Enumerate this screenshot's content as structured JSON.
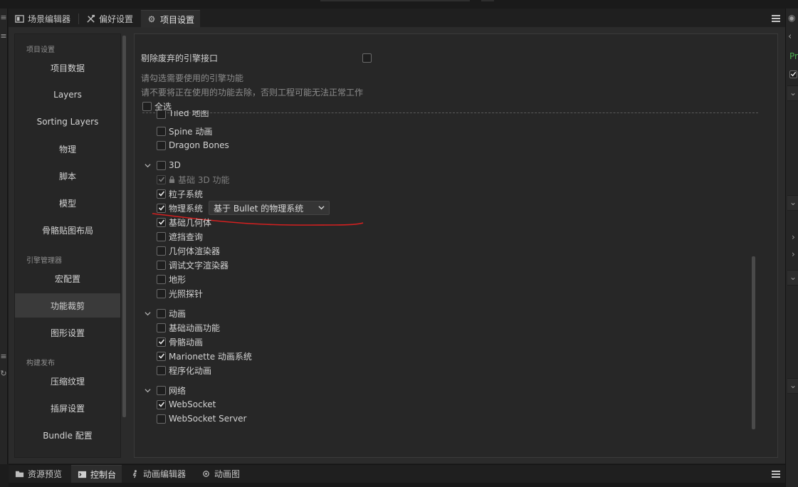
{
  "tabs": [
    {
      "label": "场景编辑器",
      "icon": "scene-editor-icon"
    },
    {
      "label": "偏好设置",
      "icon": "tools-icon"
    },
    {
      "label": "项目设置",
      "icon": "gear-icon",
      "active": true
    }
  ],
  "sidebar": {
    "sections": [
      {
        "header": "项目设置",
        "items": [
          "项目数据",
          "Layers",
          "Sorting Layers",
          "物理",
          "脚本",
          "模型",
          "骨骼贴图布局"
        ]
      },
      {
        "header": "引擎管理器",
        "items": [
          "宏配置",
          "功能裁剪",
          "图形设置"
        ]
      },
      {
        "header": "构建发布",
        "items": [
          "压缩纹理",
          "插屏设置",
          "Bundle 配置"
        ]
      }
    ],
    "selected": "功能裁剪"
  },
  "panel": {
    "deprecated_label": "剔除废弃的引擎接口",
    "hint1": "请勾选需要使用的引擎功能",
    "hint2": "请不要将正在使用的功能去除，否则工程可能无法正常工作",
    "select_all": "全选",
    "partial_top": "Tiled 地图",
    "items_2d": [
      {
        "label": "Spine 动画",
        "checked": false
      },
      {
        "label": "Dragon Bones",
        "checked": false
      }
    ],
    "group_3d": {
      "label": "3D",
      "items": [
        {
          "label": "基础 3D 功能",
          "checked": true,
          "locked": true
        },
        {
          "label": "粒子系统",
          "checked": true
        },
        {
          "label": "物理系统",
          "checked": true,
          "dropdown": "基于 Bullet 的物理系统"
        },
        {
          "label": "基础几何体",
          "checked": true
        },
        {
          "label": "遮挡查询",
          "checked": false
        },
        {
          "label": "几何体渲染器",
          "checked": false
        },
        {
          "label": "调试文字渲染器",
          "checked": false
        },
        {
          "label": "地形",
          "checked": false
        },
        {
          "label": "光照探针",
          "checked": false
        }
      ]
    },
    "group_anim": {
      "label": "动画",
      "items": [
        {
          "label": "基础动画功能",
          "checked": false
        },
        {
          "label": "骨骼动画",
          "checked": true
        },
        {
          "label": "Marionette 动画系统",
          "checked": true
        },
        {
          "label": "程序化动画",
          "checked": false
        }
      ]
    },
    "group_net": {
      "label": "网络",
      "items": [
        {
          "label": "WebSocket",
          "checked": true
        },
        {
          "label": "WebSocket Server",
          "checked": false
        }
      ]
    }
  },
  "bottom_tabs": [
    {
      "label": "资源预览",
      "icon": "asset-preview-icon"
    },
    {
      "label": "控制台",
      "icon": "console-icon",
      "active": true
    },
    {
      "label": "动画编辑器",
      "icon": "animation-editor-icon"
    },
    {
      "label": "动画图",
      "icon": "animation-graph-icon"
    }
  ],
  "right_edge": {
    "partial_label": "Pr"
  },
  "colors": {
    "annotation": "#d42020",
    "background": "#2b2b2b",
    "selected": "#3a3a3a"
  }
}
